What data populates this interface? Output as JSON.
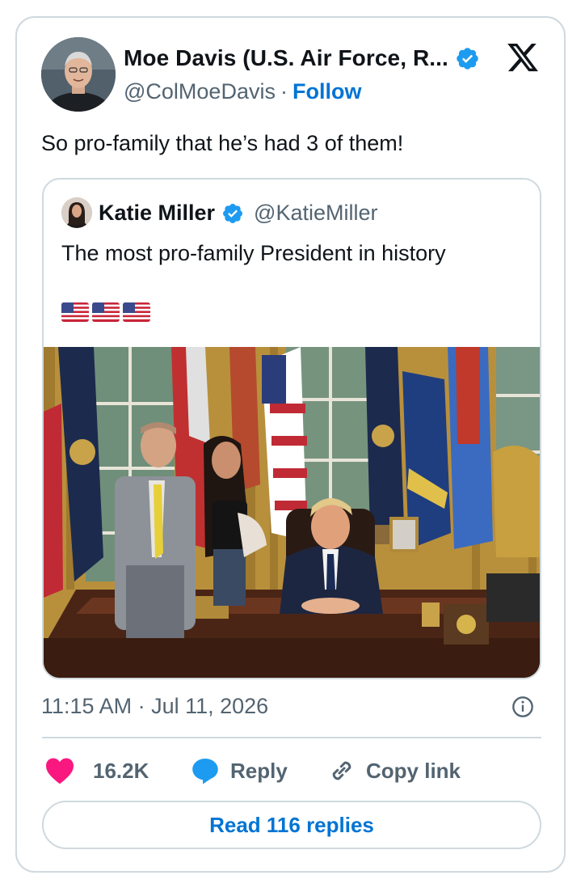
{
  "author": {
    "display_name": "Moe Davis (U.S. Air Force, R...",
    "handle": "@ColMoeDavis",
    "separator": "·",
    "follow_label": "Follow",
    "verified": true
  },
  "tweet": {
    "text": "So pro-family that he’s had 3 of them!",
    "timestamp": "11:15 AM · Jul 11, 2026"
  },
  "quote": {
    "display_name": "Katie Miller",
    "handle": "@KatieMiller",
    "text": "The most pro-family President in history",
    "emoji": [
      "us-flag",
      "us-flag",
      "us-flag"
    ],
    "photo": "oval-office-photo"
  },
  "actions": {
    "like_count": "16.2K",
    "reply_label": "Reply",
    "copy_label": "Copy link"
  },
  "read_replies_label": "Read 116 replies",
  "colors": {
    "accent": "#0074d4",
    "verified": "#1d9bf0",
    "like": "#f91880",
    "muted": "#536471",
    "border": "#cfd9de"
  },
  "icons": {
    "brand": "x-logo-icon",
    "verified": "verified-badge-icon",
    "info": "info-icon",
    "like": "heart-icon",
    "reply": "reply-bubble-icon",
    "copy": "link-icon"
  }
}
